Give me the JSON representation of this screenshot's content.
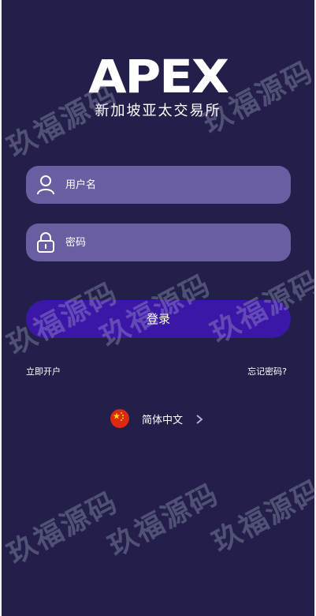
{
  "logo": {
    "word": "APEX",
    "subtitle": "新加坡亚太交易所"
  },
  "form": {
    "username_placeholder": "用户名",
    "username_value": "",
    "username_icon": "user-icon",
    "password_placeholder": "密码",
    "password_value": "",
    "password_icon": "lock-icon",
    "login_label": "登录"
  },
  "links": {
    "register": "立即开户",
    "forgot": "忘记密码?"
  },
  "language": {
    "label": "简体中文",
    "flag_icon": "china-flag-icon",
    "chevron_icon": "chevron-right-icon"
  },
  "watermark": {
    "text": "玖福源码"
  },
  "colors": {
    "background": "#22204b",
    "field": "#6a5ea3",
    "button": "#3a17a6",
    "text": "#ffffff"
  }
}
